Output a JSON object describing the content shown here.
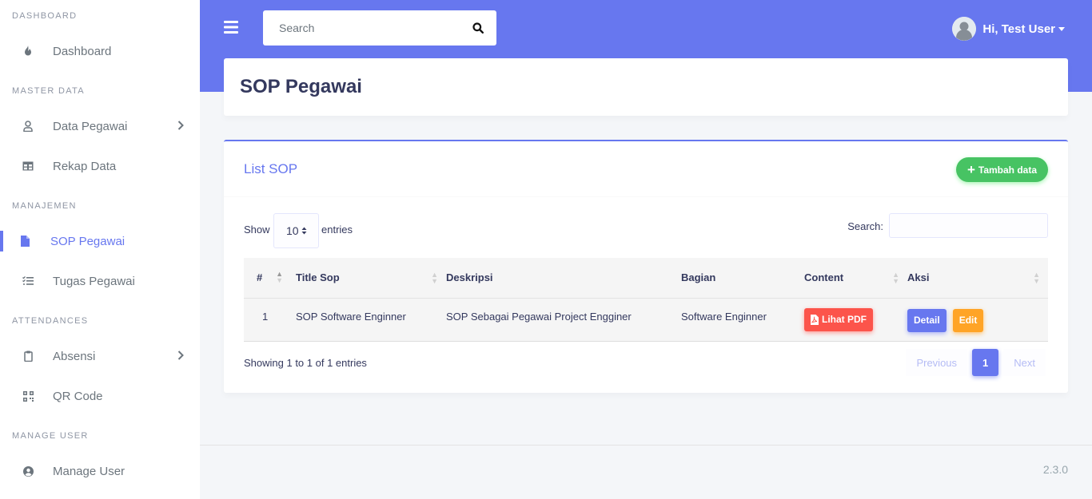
{
  "sidebar": {
    "sections": [
      {
        "header": "DASHBOARD"
      },
      {
        "header": "MASTER DATA"
      },
      {
        "header": "MANAJEMEN"
      },
      {
        "header": "ATTENDANCES"
      },
      {
        "header": "MANAGE USER"
      }
    ],
    "items": [
      {
        "label": "Dashboard",
        "icon": "fire-icon"
      },
      {
        "label": "Data Pegawai",
        "icon": "user-icon",
        "has_submenu": true
      },
      {
        "label": "Rekap Data",
        "icon": "table-icon"
      },
      {
        "label": "SOP Pegawai",
        "icon": "file-icon",
        "active": true
      },
      {
        "label": "Tugas Pegawai",
        "icon": "tasks-icon"
      },
      {
        "label": "Absensi",
        "icon": "clipboard-icon",
        "has_submenu": true
      },
      {
        "label": "QR Code",
        "icon": "qrcode-icon"
      },
      {
        "label": "Manage User",
        "icon": "user-circle-icon"
      }
    ]
  },
  "navbar": {
    "search_placeholder": "Search",
    "user_greeting": "Hi, Test User"
  },
  "page": {
    "title": "SOP Pegawai"
  },
  "card": {
    "title": "List SOP",
    "add_button": "Tambah data",
    "show_label": "Show",
    "length_value": "10",
    "entries_label": "entries",
    "search_label": "Search:"
  },
  "table": {
    "columns": [
      "#",
      "Title Sop",
      "Deskripsi",
      "Bagian",
      "Content",
      "Aksi"
    ],
    "rows": [
      {
        "no": "1",
        "title": "SOP Software Enginner",
        "deskripsi": "SOP Sebagai Pegawai Project Engginer",
        "bagian": "Software Enginner",
        "content_button": "Lihat PDF",
        "detail_button": "Detail",
        "edit_button": "Edit"
      }
    ]
  },
  "pagination": {
    "info": "Showing 1 to 1 of 1 entries",
    "previous": "Previous",
    "current": "1",
    "next": "Next"
  },
  "footer": {
    "version": "2.3.0"
  },
  "colors": {
    "primary": "#6777ef",
    "success": "#47c363",
    "danger": "#fc544b",
    "warning": "#ffa426"
  }
}
